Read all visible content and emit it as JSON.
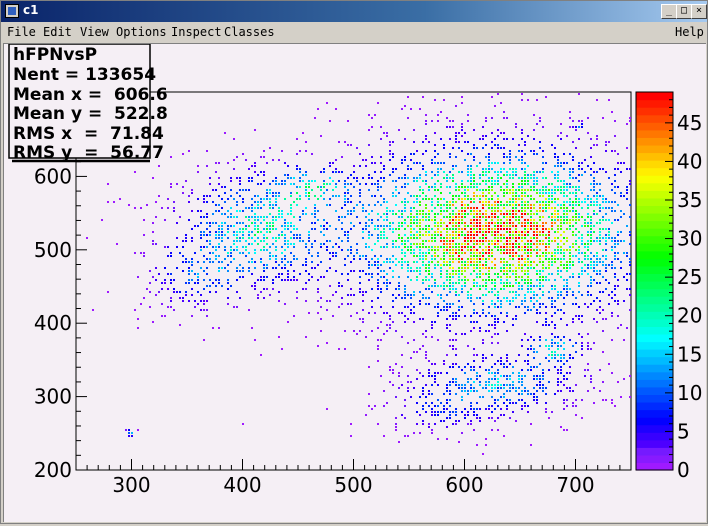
{
  "window": {
    "title": "c1"
  },
  "menu": {
    "file": "File",
    "edit": "Edit",
    "view": "View",
    "options": "Options",
    "inspect": "Inspect",
    "classes": "Classes",
    "help": "Help"
  },
  "controls": {
    "minimize": "_",
    "maximize": "□",
    "close": "×"
  },
  "stats": {
    "name": "hFPNvsP",
    "nent": "Nent = 133654",
    "mean_x": "Mean x =  606.6",
    "mean_y": "Mean y =  522.8",
    "rms_x": "RMS x  =  71.84",
    "rms_y": "RMS y  =  56.77"
  },
  "chart_data": {
    "type": "heatmap",
    "title": "hFPNvsP",
    "xlabel": "",
    "ylabel": "",
    "xlim": [
      250,
      750
    ],
    "ylim": [
      200,
      715
    ],
    "x_ticks": [
      300,
      400,
      500,
      600,
      700
    ],
    "y_ticks": [
      200,
      300,
      400,
      500,
      600
    ],
    "z_range": [
      0,
      49
    ],
    "z_ticks": [
      0,
      5,
      10,
      15,
      20,
      25,
      30,
      35,
      40,
      45
    ],
    "palette": "rainbow",
    "grid": false,
    "clusters": [
      {
        "cx": 415,
        "cy": 530,
        "sx": 38,
        "sy": 42,
        "peak": 18,
        "density": 0.55
      },
      {
        "cx": 462,
        "cy": 585,
        "sx": 22,
        "sy": 18,
        "peak": 14,
        "density": 0.45
      },
      {
        "cx": 360,
        "cy": 470,
        "sx": 25,
        "sy": 28,
        "peak": 9,
        "density": 0.35
      },
      {
        "cx": 625,
        "cy": 525,
        "sx": 70,
        "sy": 60,
        "peak": 45,
        "density": 0.85
      },
      {
        "cx": 630,
        "cy": 320,
        "sx": 40,
        "sy": 22,
        "peak": 14,
        "density": 0.55
      },
      {
        "cx": 680,
        "cy": 365,
        "sx": 14,
        "sy": 14,
        "peak": 16,
        "density": 0.5
      },
      {
        "cx": 580,
        "cy": 285,
        "sx": 30,
        "sy": 18,
        "peak": 6,
        "density": 0.35
      },
      {
        "cx": 298,
        "cy": 252,
        "sx": 3,
        "sy": 3,
        "peak": 12,
        "density": 0.9
      },
      {
        "cx": 703,
        "cy": 670,
        "sx": 3,
        "sy": 3,
        "peak": 12,
        "density": 0.9
      }
    ]
  }
}
